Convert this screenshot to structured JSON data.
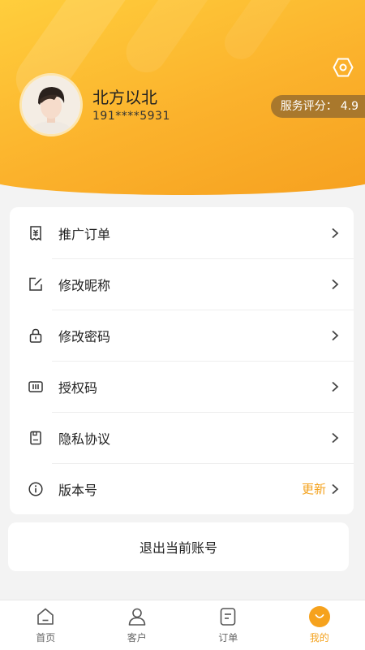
{
  "profile": {
    "name": "北方以北",
    "phone": "191****5931",
    "rating_label": "服务评分：",
    "rating_value": "4.9"
  },
  "menu": [
    {
      "icon": "receipt-icon",
      "label": "推广订单"
    },
    {
      "icon": "edit-icon",
      "label": "修改昵称"
    },
    {
      "icon": "lock-icon",
      "label": "修改密码"
    },
    {
      "icon": "barcode-icon",
      "label": "授权码"
    },
    {
      "icon": "document-icon",
      "label": "隐私协议"
    },
    {
      "icon": "info-icon",
      "label": "版本号",
      "action": "更新"
    }
  ],
  "logout_label": "退出当前账号",
  "tabs": [
    {
      "icon": "home-icon",
      "label": "首页"
    },
    {
      "icon": "user-icon",
      "label": "客户"
    },
    {
      "icon": "order-icon",
      "label": "订单"
    },
    {
      "icon": "me-icon",
      "label": "我的",
      "active": true
    }
  ],
  "colors": {
    "accent": "#f4a21d",
    "header_start": "#ffcf3d",
    "header_end": "#f6a01f",
    "rating_badge": "#a9782c"
  }
}
